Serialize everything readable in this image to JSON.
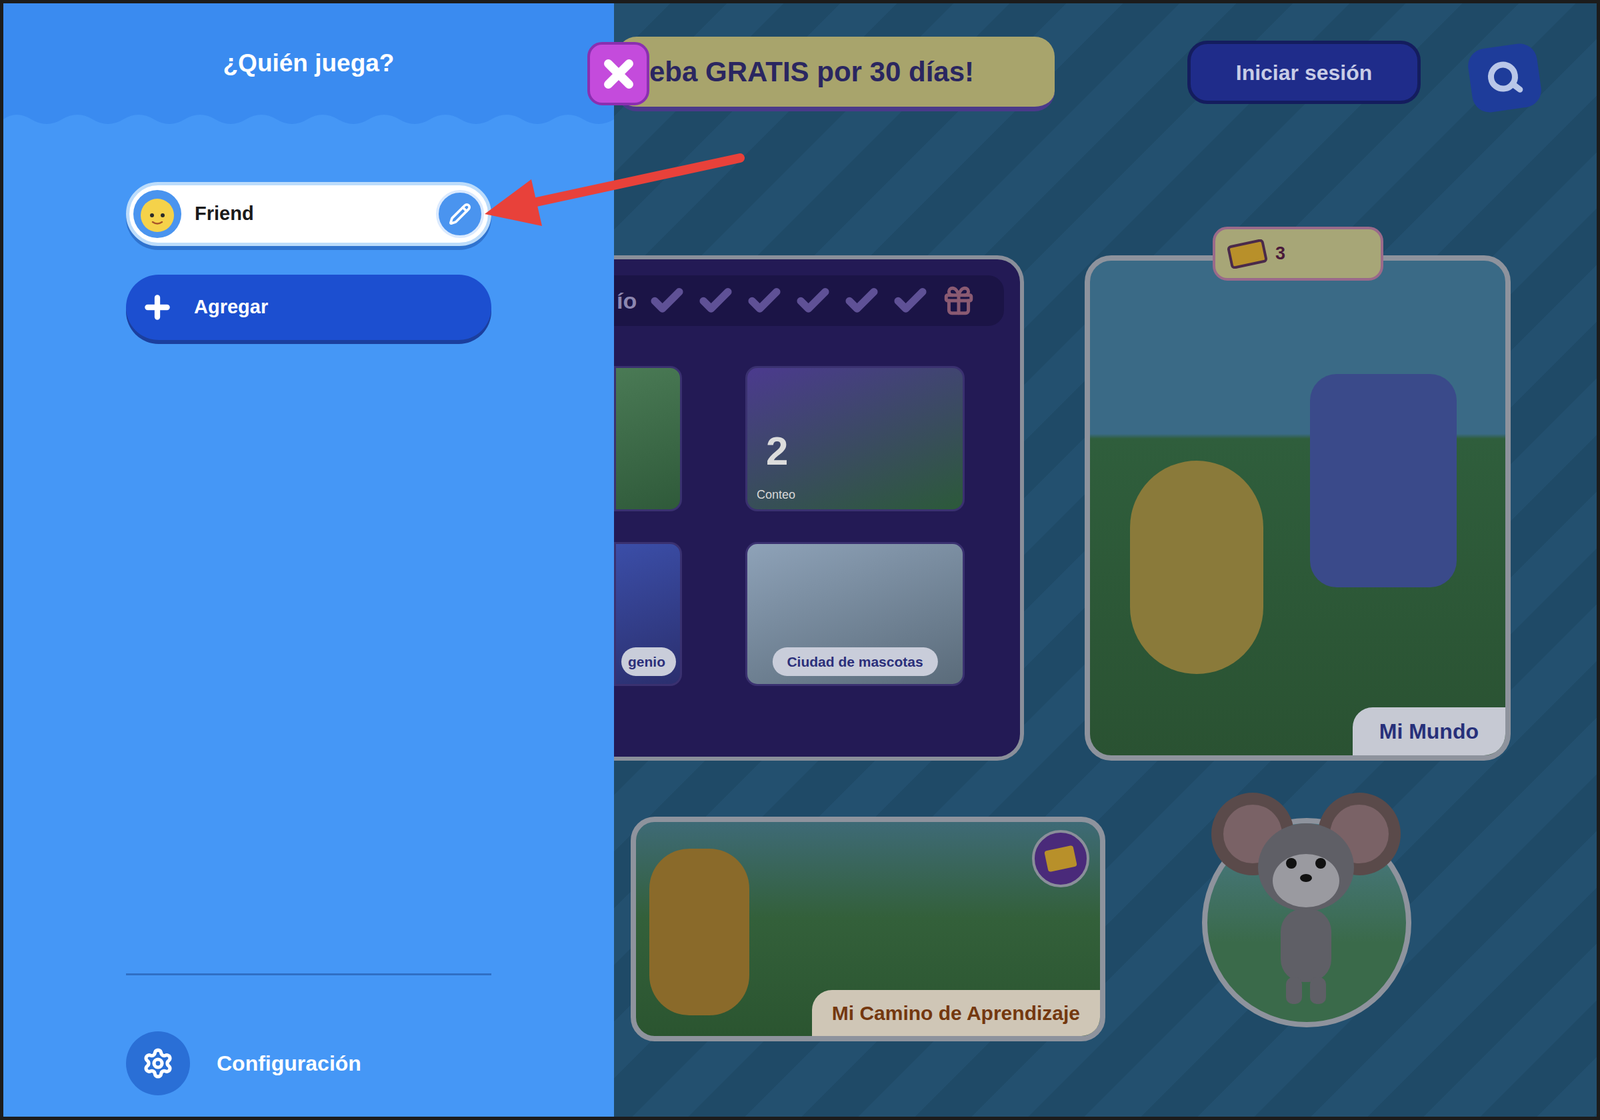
{
  "sidebar": {
    "title": "¿Quién juega?",
    "profiles": [
      {
        "name": "Friend",
        "selected": true
      }
    ],
    "add_button": "Agregar",
    "settings": "Configuración"
  },
  "banner": {
    "text": "eba GRATIS por 30 días!"
  },
  "login_button": "Iniciar sesión",
  "challenge": {
    "title": "ío",
    "checks": [
      {
        "done": false
      },
      {
        "done": false
      },
      {
        "done": false
      },
      {
        "done": false
      },
      {
        "done": false
      },
      {
        "done": false
      }
    ],
    "tiles": [
      {
        "kind": "plain",
        "number": "",
        "label": ""
      },
      {
        "kind": "number",
        "number": "2",
        "label": "Conteo"
      },
      {
        "kind": "pill",
        "number": "",
        "label": "genio"
      },
      {
        "kind": "pill",
        "number": "",
        "label": "Ciudad de mascotas"
      }
    ]
  },
  "my_world": {
    "label": "Mi Mundo",
    "tickets": "3"
  },
  "learning_path": {
    "label": "Mi Camino de Aprendizaje"
  }
}
